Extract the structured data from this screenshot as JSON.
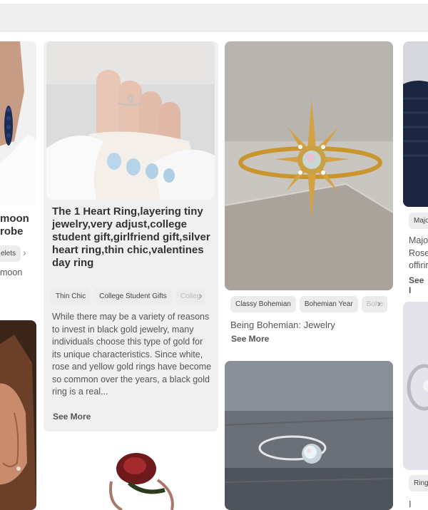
{
  "colors": {
    "card_bg": "#f0f0f0",
    "chip_bg": "#ececec",
    "text": "#333333"
  },
  "left_partial": {
    "title_line1": "moon",
    "title_line2": "robe",
    "chip": "elets",
    "desc": "moon"
  },
  "card_heart": {
    "title": "The 1 Heart Ring,layering tiny jewelry,very adjust,college student gift,girlfriend gift,silver heart ring,thin chic,valentines day ring",
    "chips": [
      "Thin Chic",
      "College Student Gifts",
      "Colleg"
    ],
    "description": "While there may be a variety of reasons to invest in black gold jewelry, many individuals choose this type of gold for its unique characteristics. Since white, rose and yellow gold rings have become so common over the years, a black gold ring is a real...",
    "see_more": "See More"
  },
  "card_star": {
    "chips": [
      "Classy Bohemian",
      "Bohemian Year",
      "Bohe"
    ],
    "description": "Being Bohemian: Jewelry",
    "see_more": "See More"
  },
  "right_partial": {
    "chip_top": "Majo",
    "desc_lines": [
      "Majo",
      "Rose",
      "offirir"
    ],
    "see_more": "See I",
    "chip_bottom": "Ring",
    "bottom_text": "I LOV"
  },
  "icons": [
    "chevron-right-icon"
  ]
}
